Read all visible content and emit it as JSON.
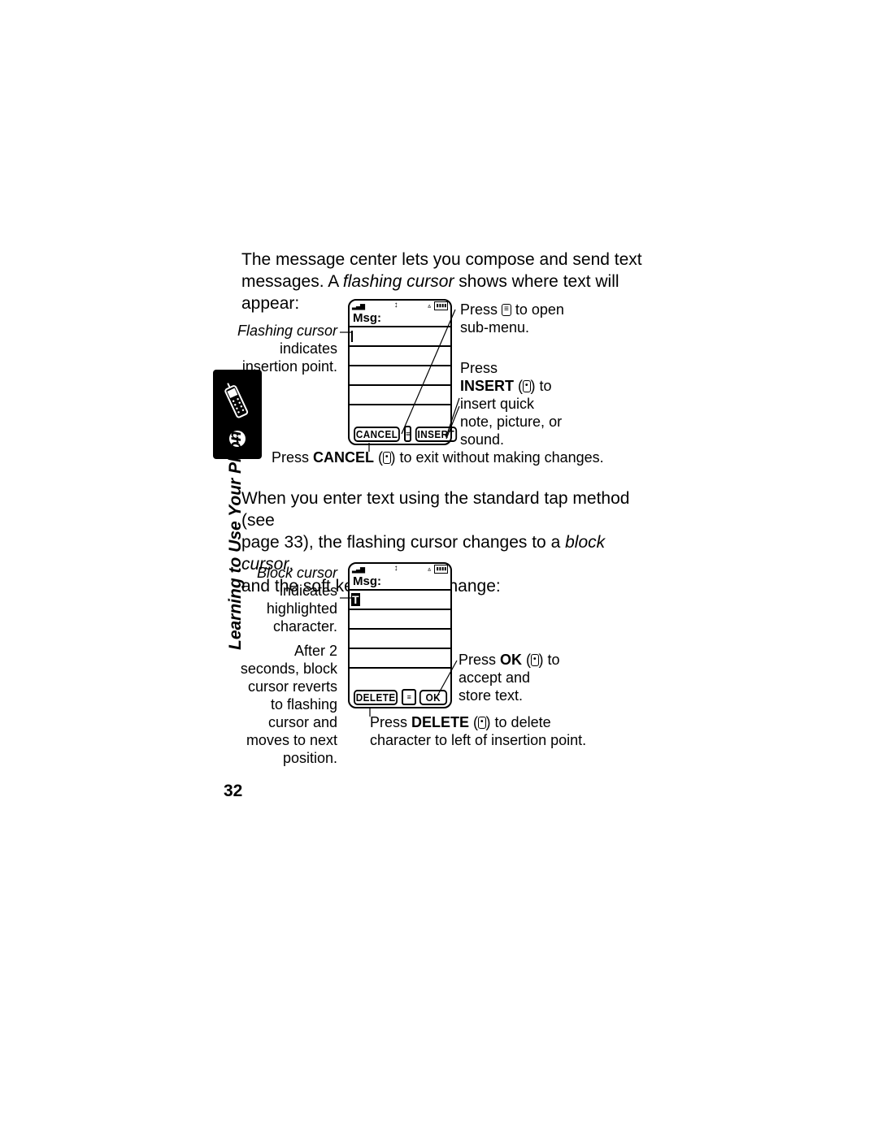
{
  "intro": {
    "line1": "The message center lets you compose and send text",
    "line2a": "messages. A ",
    "line2_italic": "flashing cursor",
    "line2b": " shows where text will appear:"
  },
  "fig1": {
    "screen_title": "Msg:",
    "softkey_left": "CANCEL",
    "softkey_right": "INSERT",
    "annot_left": {
      "l1_italic": "Flashing cursor",
      "l2": "indicates",
      "l3": "insertion point."
    },
    "annot_tr": {
      "pre": "Press ",
      "key": "≡",
      "post": " to open",
      "l2": "sub-menu."
    },
    "annot_r": {
      "l1": "Press",
      "l2_bold": "INSERT",
      "l2_key": "•",
      "l2_post": " to",
      "l3": "insert quick",
      "l4": "note, picture, or",
      "l5": "sound."
    },
    "annot_b": {
      "pre": "Press ",
      "bold": "CANCEL",
      "key": "•",
      "post": " to exit without making changes."
    }
  },
  "mid": {
    "line1": "When you enter text using the standard tap method (see",
    "line2a": "page 33), the flashing cursor changes to a ",
    "line2_italic": "block cursor",
    "line2b": ",",
    "line3": "and the soft key functions change:"
  },
  "fig2": {
    "screen_title": "Msg:",
    "block_char": "T",
    "softkey_left": "DELETE",
    "softkey_right": "OK",
    "annot_tl": {
      "l1_italic": "Block cursor",
      "l2": "indicates",
      "l3": "highlighted",
      "l4": "character."
    },
    "annot_bl": {
      "l1": "After 2",
      "l2": "seconds, block",
      "l3": "cursor reverts",
      "l4": "to flashing",
      "l5": "cursor and",
      "l6": "moves to next",
      "l7": "position."
    },
    "annot_r": {
      "pre": "Press ",
      "bold": "OK",
      "key": "•",
      "post": " to",
      "l2": "accept and",
      "l3": "store text."
    },
    "annot_b": {
      "pre": "Press ",
      "bold": "DELETE",
      "key": "•",
      "post": " to delete",
      "l2": "character to left of insertion point."
    }
  },
  "side_label": "Learning to Use Your Phone",
  "page_number": "32"
}
